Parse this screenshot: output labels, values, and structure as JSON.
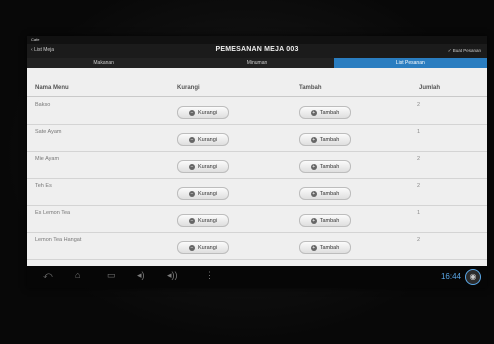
{
  "statusbar": {
    "label": "Cafe"
  },
  "actionbar": {
    "back_label": "List Meja",
    "title": "PEMESANAN MEJA 003",
    "right_label": "Buat Pesanan"
  },
  "tabs": [
    {
      "label": "Makanan",
      "active": false
    },
    {
      "label": "Minuman",
      "active": false
    },
    {
      "label": "List Pesanan",
      "active": true
    }
  ],
  "table": {
    "headers": [
      "Nama Menu",
      "Kurangi",
      "Tambah",
      "Jumlah"
    ],
    "rows": [
      {
        "name": "Bakso",
        "kurangi": "Kurangi",
        "tambah": "Tambah",
        "qty": "2"
      },
      {
        "name": "Sate Ayam",
        "kurangi": "Kurangi",
        "tambah": "Tambah",
        "qty": "1"
      },
      {
        "name": "Mie Ayam",
        "kurangi": "Kurangi",
        "tambah": "Tambah",
        "qty": "2"
      },
      {
        "name": "Teh Es",
        "kurangi": "Kurangi",
        "tambah": "Tambah",
        "qty": "2"
      },
      {
        "name": "Es Lemon Tea",
        "kurangi": "Kurangi",
        "tambah": "Tambah",
        "qty": "1"
      },
      {
        "name": "Lemon Tea Hangat",
        "kurangi": "Kurangi",
        "tambah": "Tambah",
        "qty": "2"
      }
    ]
  },
  "navbar": {
    "time": "16:44"
  },
  "colors": {
    "accent": "#2a7dc0",
    "clock": "#5aa7e6"
  }
}
